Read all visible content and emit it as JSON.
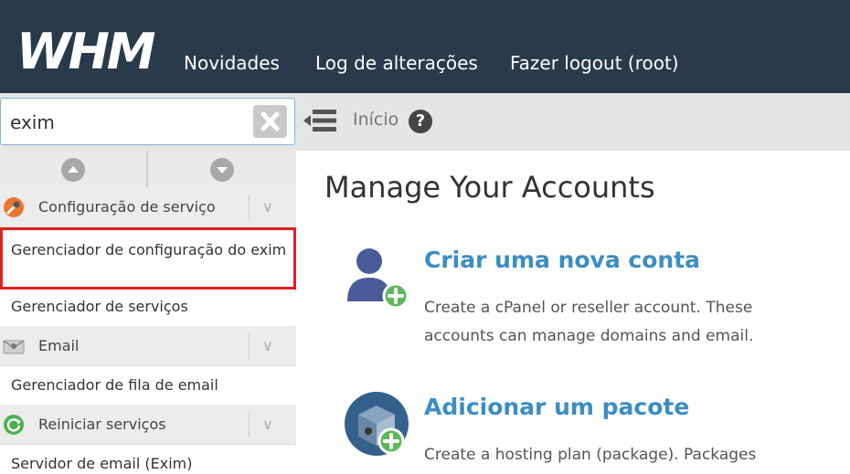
{
  "header": {
    "logo_text": "WHM",
    "nav": [
      "Novidades",
      "Log de alterações",
      "Fazer logout (root)"
    ]
  },
  "toolbar": {
    "search_value": "exim",
    "breadcrumb": "Início"
  },
  "sidebar": {
    "categories": [
      {
        "label": "Configuração de serviço"
      },
      {
        "label": "Email"
      },
      {
        "label": "Reiniciar serviços"
      }
    ],
    "items": [
      {
        "label": "Gerenciador de configuração do exim"
      },
      {
        "label": "Gerenciador de serviços"
      },
      {
        "label": "Gerenciador de fila de email"
      },
      {
        "label": "Servidor de email (Exim)"
      }
    ]
  },
  "main": {
    "title": "Manage Your Accounts",
    "features": [
      {
        "title": "Criar uma nova conta",
        "description": "Create a cPanel or reseller account. These accounts can manage domains and email."
      },
      {
        "title": "Adicionar um pacote",
        "description": "Create a hosting plan (package). Packages"
      }
    ]
  },
  "colors": {
    "topbar": "#293a4a",
    "link": "#3b8dc5",
    "highlight": "#e02020",
    "accent_green": "#5cb85c"
  }
}
